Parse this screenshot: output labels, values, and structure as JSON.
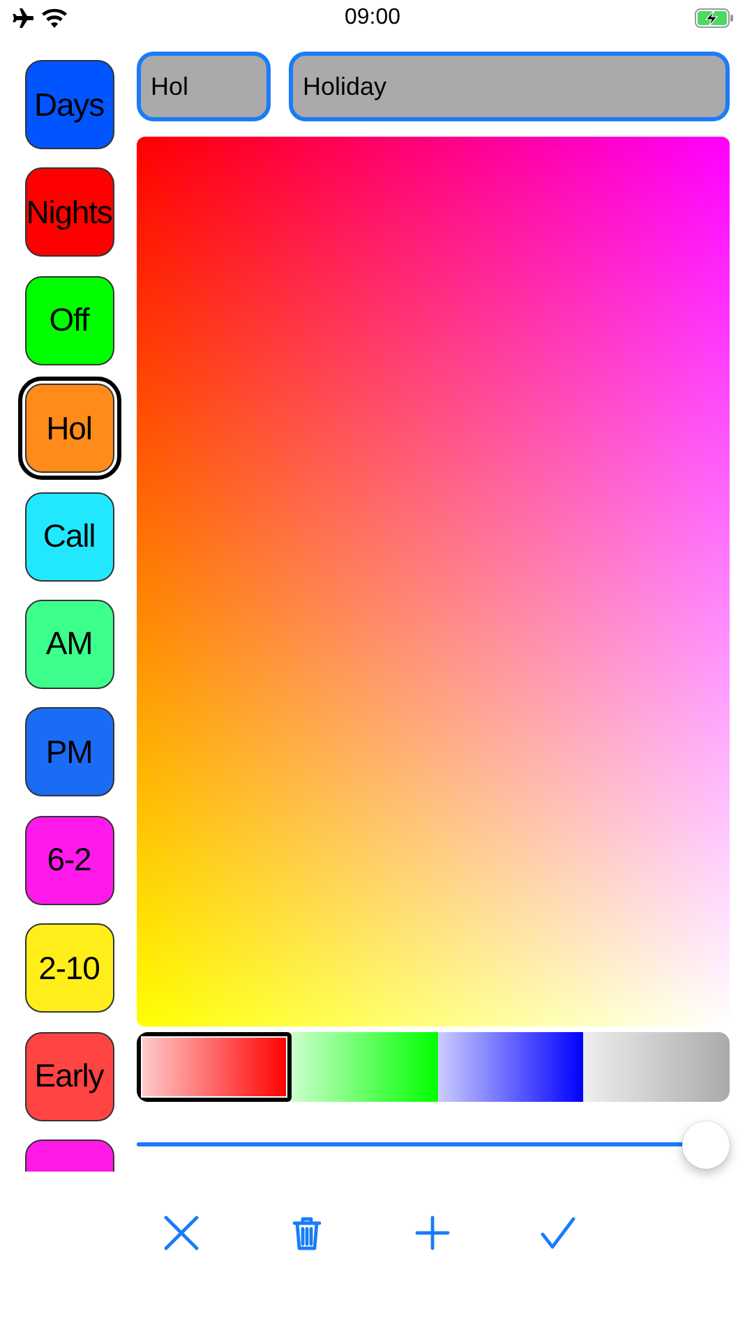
{
  "status_bar": {
    "time": "09:00",
    "airplane_mode": true,
    "charging": true
  },
  "shifts": [
    {
      "label": "Days",
      "color": "#0055ff",
      "selected": false
    },
    {
      "label": "Nights",
      "color": "#ff0000",
      "selected": false
    },
    {
      "label": "Off",
      "color": "#00ff00",
      "selected": false
    },
    {
      "label": "Hol",
      "color": "#ff8c1a",
      "selected": true
    },
    {
      "label": "Call",
      "color": "#22e8ff",
      "selected": false
    },
    {
      "label": "AM",
      "color": "#3dff8c",
      "selected": false
    },
    {
      "label": "PM",
      "color": "#1a6cf5",
      "selected": false
    },
    {
      "label": "6-2",
      "color": "#ff1aeb",
      "selected": false
    },
    {
      "label": "2-10",
      "color": "#ffee1a",
      "selected": false
    },
    {
      "label": "Early",
      "color": "#ff4444",
      "selected": false
    },
    {
      "color": "#ff1ae8",
      "selected": false
    }
  ],
  "short_name": {
    "value": "Hol"
  },
  "long_name": {
    "value": "Holiday"
  },
  "swatches": [
    {
      "color": "#ff0000",
      "selected": true
    },
    {
      "color": "#00ff00",
      "selected": false
    },
    {
      "color": "#0000ff",
      "selected": false
    },
    {
      "color": "#aaaaaa",
      "selected": false
    }
  ],
  "brightness": {
    "level": 1
  },
  "toolbar": [
    {
      "kind": "cancel"
    },
    {
      "kind": "delete"
    },
    {
      "kind": "add"
    },
    {
      "kind": "confirm"
    }
  ]
}
